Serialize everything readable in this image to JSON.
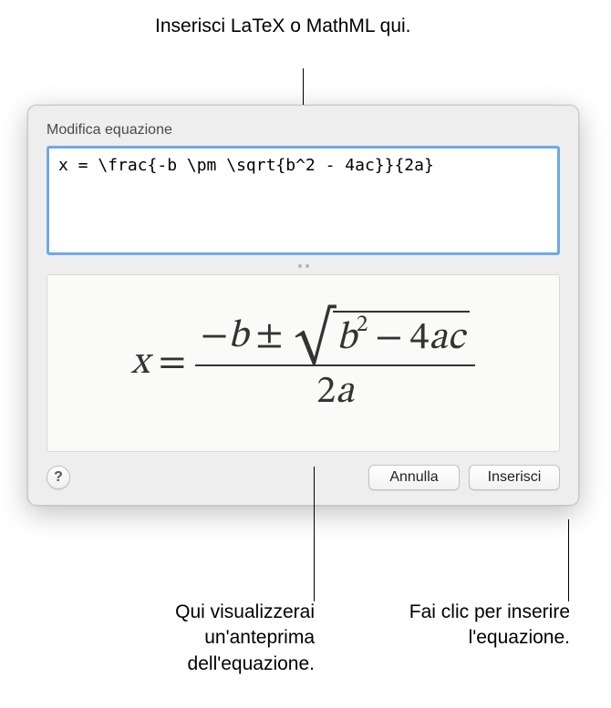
{
  "callouts": {
    "top": "Inserisci LaTeX o MathML qui.",
    "bottom_left": "Qui visualizzerai un'anteprima dell'equazione.",
    "bottom_right": "Fai clic per inserire l'equazione."
  },
  "dialog": {
    "title": "Modifica equazione",
    "latex_value": "x = \\frac{-b \\pm \\sqrt{b^2 - 4ac}}{2a}",
    "help_label": "?",
    "cancel_label": "Annulla",
    "insert_label": "Inserisci"
  },
  "preview": {
    "lhs_var": "x",
    "equals": "=",
    "minus": "−",
    "b": "b",
    "pm": "±",
    "sup2": "2",
    "four": "4",
    "a": "a",
    "c": "c",
    "two": "2"
  }
}
